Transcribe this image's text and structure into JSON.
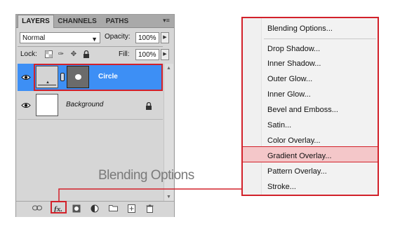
{
  "layers_panel": {
    "tabs": [
      "LAYERS",
      "CHANNELS",
      "PATHS"
    ],
    "blend_mode": "Normal",
    "opacity_label": "Opacity:",
    "opacity_value": "100%",
    "lock_label": "Lock:",
    "fill_label": "Fill:",
    "fill_value": "100%",
    "layers": [
      {
        "name": "Circle",
        "selected": true
      },
      {
        "name": "Background",
        "selected": false,
        "locked": true
      }
    ]
  },
  "caption": "Blending Options",
  "menu": {
    "items": [
      "Blending Options...",
      "Drop Shadow...",
      "Inner Shadow...",
      "Outer Glow...",
      "Inner Glow...",
      "Bevel and Emboss...",
      "Satin...",
      "Color Overlay...",
      "Gradient Overlay...",
      "Pattern Overlay...",
      "Stroke..."
    ],
    "highlighted": "Gradient Overlay..."
  },
  "colors": {
    "accent_red": "#d2212a",
    "selection_blue": "#3d8ff5",
    "highlight_pink": "#f4c7c9"
  }
}
